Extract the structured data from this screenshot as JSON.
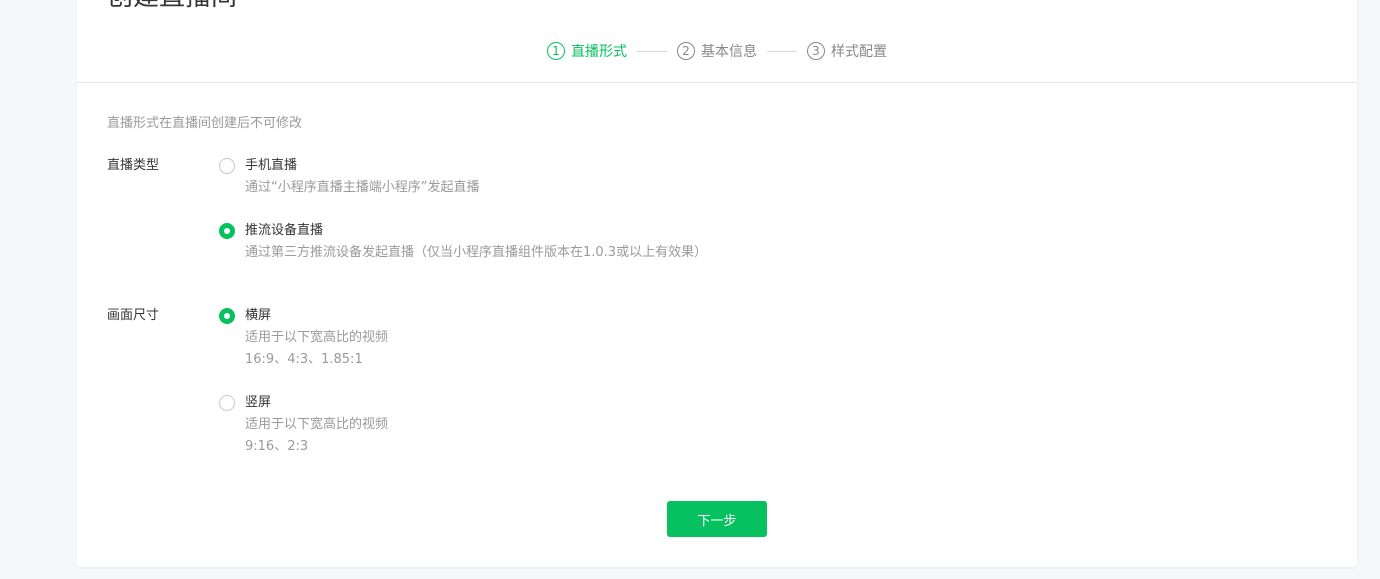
{
  "page": {
    "title": "创建直播间"
  },
  "steps": [
    {
      "num": "1",
      "label": "直播形式",
      "active": true
    },
    {
      "num": "2",
      "label": "基本信息",
      "active": false
    },
    {
      "num": "3",
      "label": "样式配置",
      "active": false
    }
  ],
  "form": {
    "hint": "直播形式在直播间创建后不可修改",
    "live_type": {
      "label": "直播类型",
      "options": [
        {
          "title": "手机直播",
          "desc": "通过“小程序直播主播端小程序”发起直播",
          "checked": false
        },
        {
          "title": "推流设备直播",
          "desc": "通过第三方推流设备发起直播（仅当小程序直播组件版本在1.0.3或以上有效果）",
          "checked": true
        }
      ]
    },
    "screen_size": {
      "label": "画面尺寸",
      "options": [
        {
          "title": "横屏",
          "desc1": "适用于以下宽高比的视频",
          "desc2": "16:9、4:3、1.85:1",
          "checked": true
        },
        {
          "title": "竖屏",
          "desc1": "适用于以下宽高比的视频",
          "desc2": "9:16、2:3",
          "checked": false
        }
      ]
    },
    "next_button": "下一步"
  },
  "colors": {
    "accent": "#07c160",
    "muted_text": "#9a9a9a",
    "page_bg": "#f6f7f9"
  }
}
